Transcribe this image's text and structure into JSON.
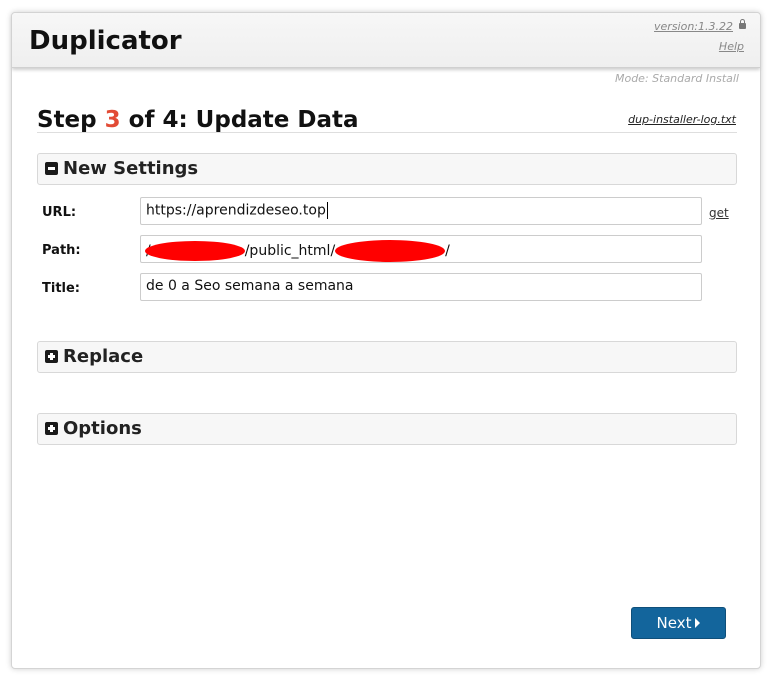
{
  "header": {
    "title": "Duplicator",
    "version": "version:1.3.22",
    "help": "Help"
  },
  "mode": "Mode: Standard Install",
  "step": {
    "prefix": "Step ",
    "number": "3",
    "suffix": " of 4: Update Data",
    "log_link": "dup-installer-log.txt"
  },
  "sections": {
    "new_settings": {
      "label": "New Settings",
      "fields": {
        "url": {
          "label": "URL:",
          "value": "https://aprendizdeseo.top",
          "action": "get"
        },
        "path": {
          "label": "Path:",
          "value_prefix": "/",
          "value_mid": "/public_html/",
          "value_suffix": "/"
        },
        "title": {
          "label": "Title:",
          "value": "de 0 a Seo semana a semana"
        }
      }
    },
    "replace": {
      "label": "Replace"
    },
    "options": {
      "label": "Options"
    }
  },
  "next_button": "Next"
}
